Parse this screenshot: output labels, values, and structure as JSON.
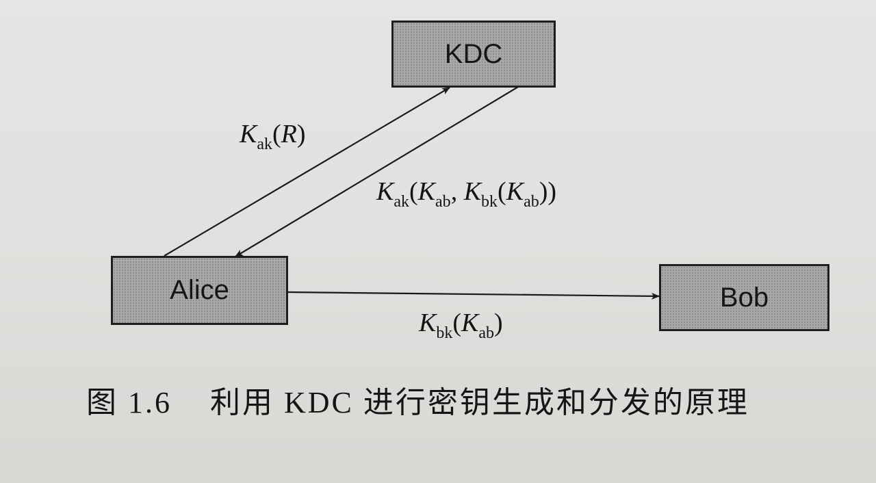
{
  "nodes": {
    "kdc": "KDC",
    "alice": "Alice",
    "bob": "Bob"
  },
  "edges": {
    "alice_to_kdc": {
      "k": "K",
      "k_sub": "ak",
      "open": "(",
      "r": "R",
      "close": ")"
    },
    "kdc_to_alice": {
      "k1": "K",
      "k1_sub": "ak",
      "open1": "(",
      "k2": "K",
      "k2_sub": "ab",
      "comma": ", ",
      "k3": "K",
      "k3_sub": "bk",
      "open2": "(",
      "k4": "K",
      "k4_sub": "ab",
      "close": "))"
    },
    "alice_to_bob": {
      "k1": "K",
      "k1_sub": "bk",
      "open": "(",
      "k2": "K",
      "k2_sub": "ab",
      "close": ")"
    }
  },
  "caption": {
    "number": "图 1.6",
    "text": "利用 KDC 进行密钥生成和分发的原理"
  }
}
